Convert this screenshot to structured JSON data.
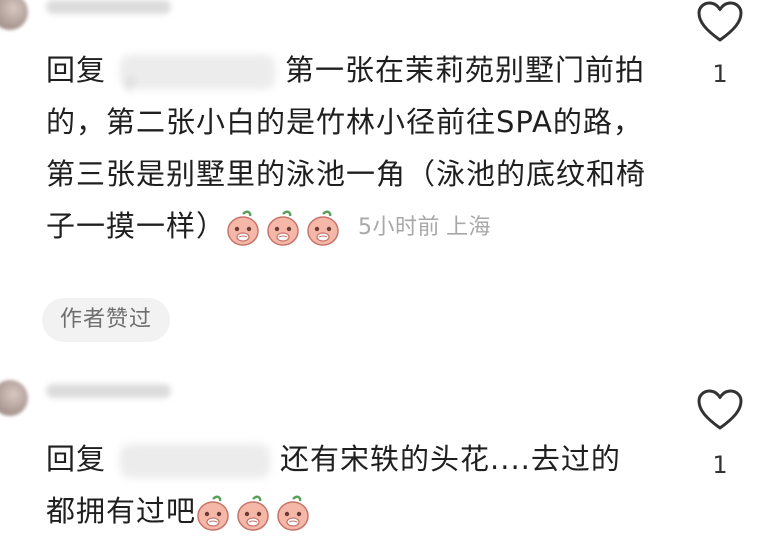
{
  "comments": [
    {
      "reply_label": "回复",
      "reply_target_visible": "r",
      "text": "第一张在茉莉苑别墅门前拍的，第二张小白的是竹林小径前往SPA的路，第三张是别墅里的泳池一角（泳池的底纹和椅子一摸一样）",
      "emojis": [
        "peach-cover-face-emoji",
        "peach-cover-face-emoji",
        "peach-cover-face-emoji"
      ],
      "time": "5小时前",
      "location": "上海",
      "author_liked": "作者赞过",
      "like_count": "1"
    },
    {
      "reply_label": "回复",
      "reply_target_visible": "",
      "text": "还有宋轶的头花....去过的都拥有过吧",
      "emojis": [
        "peach-cover-face-emoji",
        "peach-cover-face-emoji",
        "peach-cover-face-emoji"
      ],
      "like_count": "1"
    }
  ],
  "icons": {
    "like": "heart-outline-icon",
    "emoji": "peach-cover-face-emoji"
  },
  "colors": {
    "text": "#1f1f1f",
    "meta": "#a8a8a8",
    "badge_bg": "#f2f2f2",
    "badge_text": "#6e6e6e",
    "emoji_face": "#f5b7a8",
    "emoji_leaf": "#5aa05a"
  }
}
